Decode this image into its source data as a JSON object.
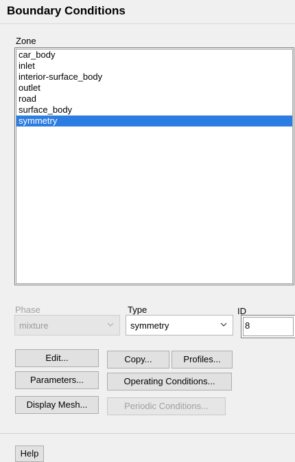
{
  "panel": {
    "title": "Boundary Conditions"
  },
  "zone": {
    "label": "Zone",
    "items": [
      "car_body",
      "inlet",
      "interior-surface_body",
      "outlet",
      "road",
      "surface_body",
      "symmetry"
    ],
    "selected": "symmetry"
  },
  "phase": {
    "label": "Phase",
    "value": "mixture"
  },
  "type": {
    "label": "Type",
    "value": "symmetry"
  },
  "id": {
    "label": "ID",
    "value": "8"
  },
  "buttons": {
    "edit": "Edit...",
    "copy": "Copy...",
    "profiles": "Profiles...",
    "parameters": "Parameters...",
    "operating_conditions": "Operating Conditions...",
    "display_mesh": "Display Mesh...",
    "periodic_conditions": "Periodic Conditions...",
    "help": "Help"
  },
  "colors": {
    "selection": "#2c7de1",
    "background": "#f0f0f0"
  }
}
